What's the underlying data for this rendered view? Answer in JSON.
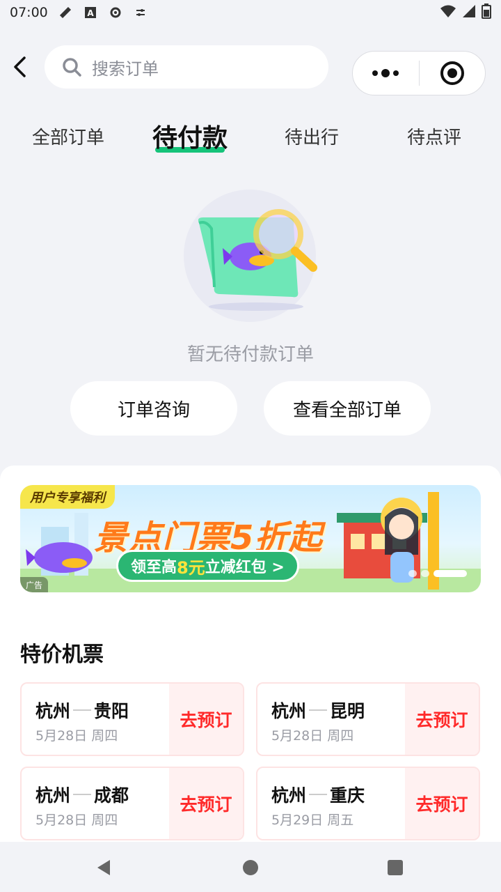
{
  "status": {
    "time": "07:00",
    "icons": [
      "tools-icon",
      "a-icon",
      "settings-icon",
      "sliders-icon"
    ],
    "right_icons": [
      "wifi-icon",
      "signal-icon",
      "battery-icon"
    ]
  },
  "header": {
    "search_placeholder": "搜索订单"
  },
  "tabs": [
    {
      "label": "全部订单",
      "active": false
    },
    {
      "label": "待付款",
      "active": true
    },
    {
      "label": "待出行",
      "active": false
    },
    {
      "label": "待点评",
      "active": false
    }
  ],
  "empty": {
    "message": "暂无待付款订单",
    "btn_consult": "订单咨询",
    "btn_all": "查看全部订单"
  },
  "banner": {
    "badge": "用户专享福利",
    "headline": "景点门票5折起",
    "sub_prefix": "领至高",
    "sub_highlight": "8元",
    "sub_suffix": "立减红包 >",
    "ad_tag": "广告"
  },
  "section_title": "特价机票",
  "flights": [
    {
      "from": "杭州",
      "to": "贵阳",
      "date": "5月28日 周四",
      "action": "去预订"
    },
    {
      "from": "杭州",
      "to": "昆明",
      "date": "5月28日 周四",
      "action": "去预订"
    },
    {
      "from": "杭州",
      "to": "成都",
      "date": "5月28日 周四",
      "action": "去预订"
    },
    {
      "from": "杭州",
      "to": "重庆",
      "date": "5月29日 周五",
      "action": "去预订"
    }
  ],
  "colors": {
    "accent_green": "#16c37a",
    "price_red": "#ff2a2a",
    "background": "#f2f3f7"
  }
}
